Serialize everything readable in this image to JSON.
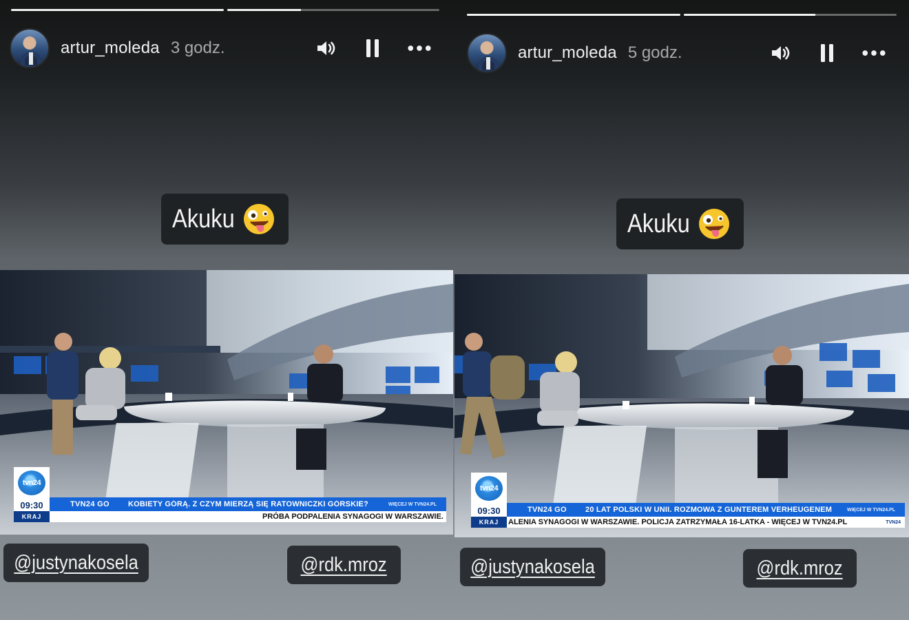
{
  "stories": [
    {
      "username": "artur_moleda",
      "time": "3 godz.",
      "caption": "Akuku",
      "progress": [
        1.0,
        0.35
      ],
      "ticker": {
        "logo": "tvn24",
        "clock": "09:30",
        "section": "KRAJ",
        "program": "TVN24 GO",
        "headline": "KOBIETY GÓRĄ. Z CZYM MIERZĄ SIĘ RATOWNICZKI GÓRSKIE?",
        "more": "WIĘCEJ W TVN24.PL",
        "crawl": "PRÓBA PODPALENIA SYNAGOGI W WARSZAWIE."
      },
      "mentions": [
        "@justynakosela",
        "@rdk.mroz"
      ]
    },
    {
      "username": "artur_moleda",
      "time": "5 godz.",
      "caption": "Akuku",
      "progress": [
        1.0,
        0.62
      ],
      "ticker": {
        "logo": "tvn24",
        "clock": "09:30",
        "section": "KRAJ",
        "program": "TVN24 GO",
        "headline": "20 LAT POLSKI W UNII. ROZMOWA Z GUNTEREM VERHEUGENEM",
        "more": "WIĘCEJ W TVN24.PL",
        "crawl": "ALENIA SYNAGOGI W WARSZAWIE. POLICJA ZATRZYMAŁA 16-LATKA - WIĘCEJ W TVN24.PL",
        "tag": "TVN24"
      },
      "mentions": [
        "@justynakosela",
        "@rdk.mroz"
      ]
    }
  ],
  "icons": {
    "sound": "speaker-icon",
    "pause": "pause-icon",
    "more": "more-options-icon",
    "emoji": "zany-face-emoji-icon"
  },
  "colors": {
    "ticker_blue": "#1565d8",
    "ticker_navy": "#0d3c8a",
    "caption_bg": "#1f2224"
  }
}
